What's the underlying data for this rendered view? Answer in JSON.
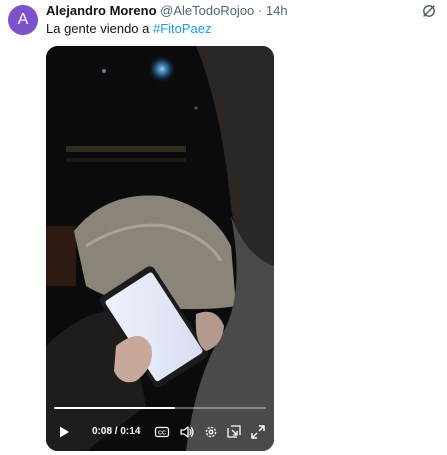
{
  "tweet": {
    "avatar_initial": "A",
    "author_name": "Alejandro Moreno",
    "author_handle": "@AleTodoRojoo",
    "separator": "·",
    "time": "14h",
    "text_prefix": "La gente viendo a ",
    "hashtag": "#FitoPaez",
    "colors": {
      "avatar": "#7c52c8",
      "link": "#1d9bf0",
      "secondary": "#536471"
    }
  },
  "video": {
    "current_time": "0:08",
    "duration": "0:14",
    "time_separator": " / ",
    "progress_fraction": 0.57,
    "captions_label": "CC",
    "icons": [
      "play-icon",
      "captions-icon",
      "volume-icon",
      "settings-icon",
      "pip-icon",
      "fullscreen-icon"
    ]
  }
}
